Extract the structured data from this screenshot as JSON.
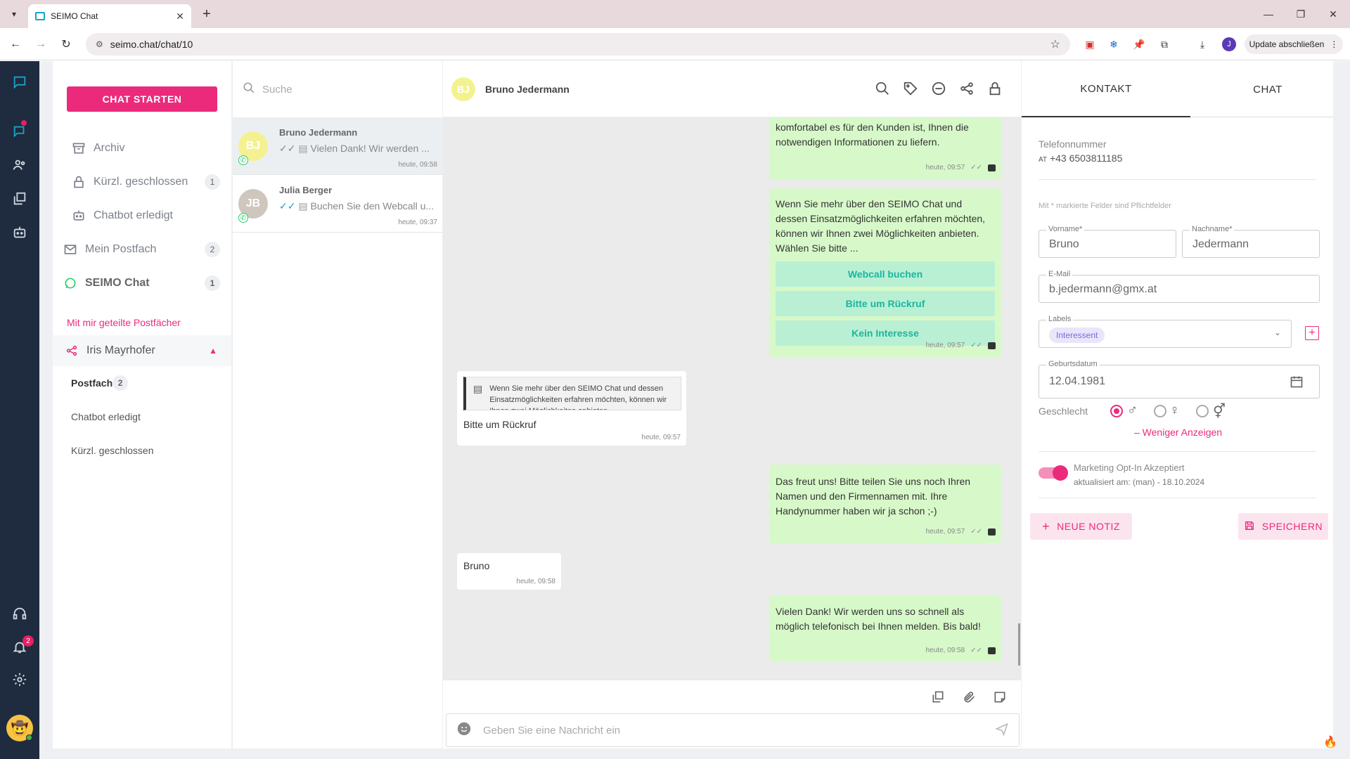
{
  "browser": {
    "tab_title": "SEIMO Chat",
    "url": "seimo.chat/chat/10",
    "update_label": "Update abschließen",
    "profile_initial": "J"
  },
  "rail": {
    "notification_count": "2"
  },
  "sidebar": {
    "start_button": "CHAT STARTEN",
    "items": [
      {
        "label": "Archiv",
        "count": ""
      },
      {
        "label": "Kürzl. geschlossen",
        "count": "1"
      },
      {
        "label": "Chatbot erledigt",
        "count": ""
      },
      {
        "label": "Mein Postfach",
        "count": "2"
      },
      {
        "label": "SEIMO Chat",
        "count": "1"
      }
    ],
    "shared_title": "Mit mir geteilte Postfächer",
    "shared_group": "Iris Mayrhofer",
    "shared_items": [
      {
        "label": "Postfach",
        "count": "2"
      },
      {
        "label": "Chatbot erledigt",
        "count": ""
      },
      {
        "label": "Kürzl. geschlossen",
        "count": ""
      }
    ]
  },
  "chatlist": {
    "search_placeholder": "Suche",
    "items": [
      {
        "initials": "BJ",
        "name": "Bruno Jedermann",
        "preview": "Vielen Dank! Wir werden ...",
        "time": "heute, 09:58",
        "avatar_color": "#f4f290"
      },
      {
        "initials": "JB",
        "name": "Julia Berger",
        "preview": "Buchen Sie den Webcall u...",
        "time": "heute, 09:37",
        "avatar_color": "#cfc6bd"
      }
    ]
  },
  "chat": {
    "contact_initials": "BJ",
    "contact_name": "Bruno Jedermann",
    "messages": [
      {
        "text": "komfortabel es für den Kunden ist, Ihnen die notwendigen Informationen zu liefern.",
        "time": "heute, 09:57"
      },
      {
        "text": "Wenn Sie mehr über den SEIMO Chat und dessen Einsatzmöglichkeiten erfahren möchten, können wir Ihnen zwei Möglichkeiten anbieten. Wählen Sie bitte ...",
        "time": "heute, 09:57",
        "buttons": [
          "Webcall buchen",
          "Bitte um Rückruf",
          "Kein Interesse"
        ]
      },
      {
        "quote": "Wenn Sie mehr über den SEIMO Chat und dessen Einsatzmöglichkeiten erfahren möchten, können wir Ihnen zwei Möglichkeiten anbieten.",
        "text": "Bitte um Rückruf",
        "time": "heute, 09:57"
      },
      {
        "text": "Das freut uns! Bitte teilen Sie uns noch Ihren Namen und den Firmennamen mit. Ihre Handynummer haben wir ja schon ;-)",
        "time": "heute, 09:57"
      },
      {
        "text": "Bruno",
        "time": "heute, 09:58"
      },
      {
        "text": "Vielen Dank! Wir werden uns so schnell als möglich telefonisch bei Ihnen melden. Bis bald!",
        "time": "heute, 09:58"
      }
    ],
    "composer_placeholder": "Geben Sie eine Nachricht ein"
  },
  "panel": {
    "tab_contact": "KONTAKT",
    "tab_chat": "CHAT",
    "phone_label": "Telefonnummer",
    "phone_country": "AT",
    "phone_value": "+43 6503811185",
    "required_hint": "Mit * markierte Felder sind Pflichtfelder",
    "firstname_label": "Vorname*",
    "firstname_value": "Bruno",
    "lastname_label": "Nachname*",
    "lastname_value": "Jedermann",
    "email_label": "E-Mail",
    "email_value": "b.jedermann@gmx.at",
    "labels_label": "Labels",
    "label_chip": "Interessent",
    "birthdate_label": "Geburtsdatum",
    "birthdate_value": "12.04.1981",
    "gender_label": "Geschlecht",
    "less_link": "– Weniger Anzeigen",
    "optin_title": "Marketing Opt-In Akzeptiert",
    "optin_sub": "aktualisiert am: (man) - 18.10.2024",
    "note_button": "NEUE NOTIZ",
    "save_button": "SPEICHERN"
  },
  "colors": {
    "accent": "#ec2a7c",
    "rail": "#1f2b3e",
    "bubble_out": "#d7f9c9",
    "quick_reply": "#b9f0d4"
  }
}
